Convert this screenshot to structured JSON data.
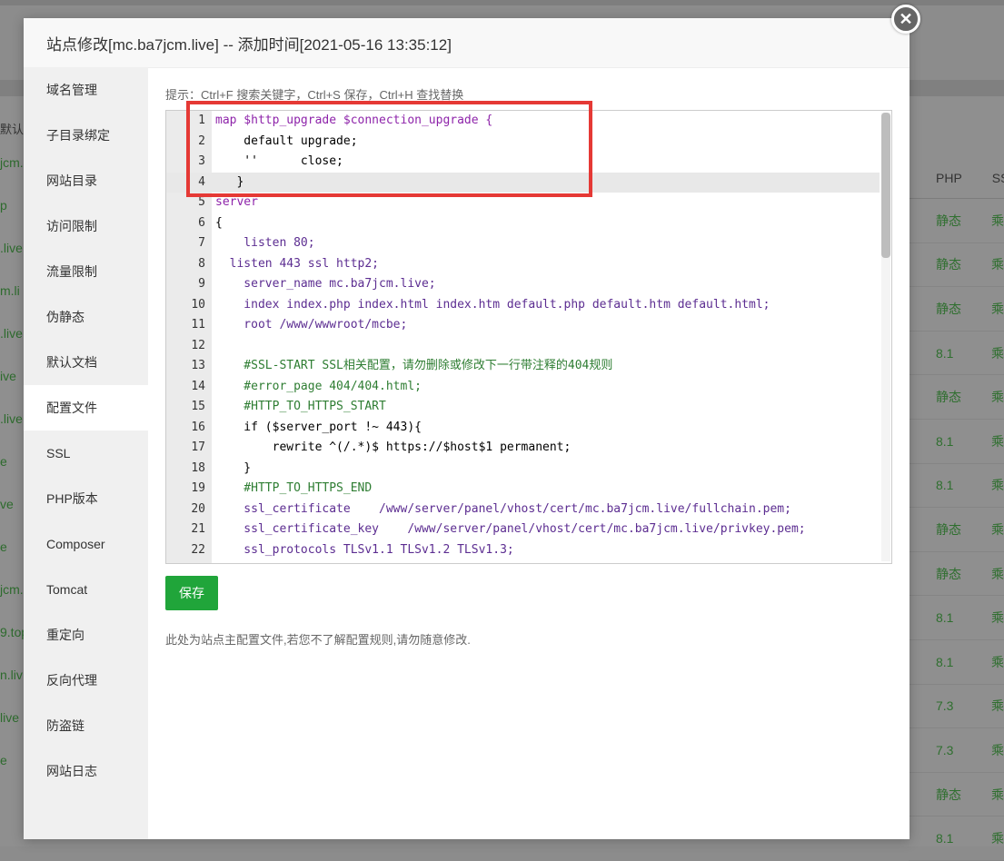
{
  "background": {
    "left_partial_labels": [
      "默认",
      "jcm.",
      "p",
      ".live",
      "m.li",
      ".live",
      "ive",
      ".live",
      "e",
      "ve",
      "e",
      "jcm.",
      "9.top",
      "n.liv",
      "live",
      "e"
    ],
    "table_headers": {
      "php": "PHP",
      "ssl": "SS"
    },
    "rows": [
      {
        "php": "静态",
        "ssl": "乘"
      },
      {
        "php": "静态",
        "ssl": "乘"
      },
      {
        "php": "静态",
        "ssl": "乘"
      },
      {
        "php": "8.1",
        "ssl": "乘"
      },
      {
        "php": "静态",
        "ssl": "乘"
      },
      {
        "php": "8.1",
        "ssl": "乘"
      },
      {
        "php": "8.1",
        "ssl": "乘"
      },
      {
        "php": "静态",
        "ssl": "乘"
      },
      {
        "php": "静态",
        "ssl": "乘"
      },
      {
        "php": "8.1",
        "ssl": "乘"
      },
      {
        "php": "8.1",
        "ssl": "乘"
      },
      {
        "php": "7.3",
        "ssl": "乘"
      },
      {
        "php": "7.3",
        "ssl": "乘"
      },
      {
        "php": "静态",
        "ssl": "乘"
      },
      {
        "php": "8.1",
        "ssl": "乘"
      }
    ]
  },
  "modal": {
    "title": "站点修改[mc.ba7jcm.live] -- 添加时间[2021-05-16 13:35:12]",
    "close_symbol": "✕",
    "sidebar": [
      {
        "label": "域名管理",
        "active": false
      },
      {
        "label": "子目录绑定",
        "active": false
      },
      {
        "label": "网站目录",
        "active": false
      },
      {
        "label": "访问限制",
        "active": false
      },
      {
        "label": "流量限制",
        "active": false
      },
      {
        "label": "伪静态",
        "active": false
      },
      {
        "label": "默认文档",
        "active": false
      },
      {
        "label": "配置文件",
        "active": true
      },
      {
        "label": "SSL",
        "active": false
      },
      {
        "label": "PHP版本",
        "active": false
      },
      {
        "label": "Composer",
        "active": false
      },
      {
        "label": "Tomcat",
        "active": false
      },
      {
        "label": "重定向",
        "active": false
      },
      {
        "label": "反向代理",
        "active": false
      },
      {
        "label": "防盗链",
        "active": false
      },
      {
        "label": "网站日志",
        "active": false
      }
    ],
    "tip": "提示：Ctrl+F 搜索关键字，Ctrl+S 保存，Ctrl+H 查找替换",
    "editor_lines": [
      {
        "n": "1",
        "text": "map $http_upgrade $connection_upgrade {"
      },
      {
        "n": "2",
        "text": "    default upgrade;"
      },
      {
        "n": "3",
        "text": "    ''      close;"
      },
      {
        "n": "4",
        "text": "   }"
      },
      {
        "n": "5",
        "text": "server"
      },
      {
        "n": "6",
        "text": "{"
      },
      {
        "n": "7",
        "text": "    listen 80;"
      },
      {
        "n": "8",
        "text": "  listen 443 ssl http2;"
      },
      {
        "n": "9",
        "text": "    server_name mc.ba7jcm.live;"
      },
      {
        "n": "10",
        "text": "    index index.php index.html index.htm default.php default.htm default.html;"
      },
      {
        "n": "11",
        "text": "    root /www/wwwroot/mcbe;"
      },
      {
        "n": "12",
        "text": ""
      },
      {
        "n": "13",
        "text": "    #SSL-START SSL相关配置，请勿删除或修改下一行带注释的404规则"
      },
      {
        "n": "14",
        "text": "    #error_page 404/404.html;"
      },
      {
        "n": "15",
        "text": "    #HTTP_TO_HTTPS_START"
      },
      {
        "n": "16",
        "text": "    if ($server_port !~ 443){"
      },
      {
        "n": "17",
        "text": "        rewrite ^(/.*)$ https://$host$1 permanent;"
      },
      {
        "n": "18",
        "text": "    }"
      },
      {
        "n": "19",
        "text": "    #HTTP_TO_HTTPS_END"
      },
      {
        "n": "20",
        "text": "    ssl_certificate    /www/server/panel/vhost/cert/mc.ba7jcm.live/fullchain.pem;"
      },
      {
        "n": "21",
        "text": "    ssl_certificate_key    /www/server/panel/vhost/cert/mc.ba7jcm.live/privkey.pem;"
      },
      {
        "n": "22",
        "text": "    ssl_protocols TLSv1.1 TLSv1.2 TLSv1.3;"
      }
    ],
    "save_label": "保存",
    "note": "此处为站点主配置文件,若您不了解配置规则,请勿随意修改."
  },
  "colors": {
    "accent": "#20a53a",
    "highlight_box": "#e53935"
  }
}
